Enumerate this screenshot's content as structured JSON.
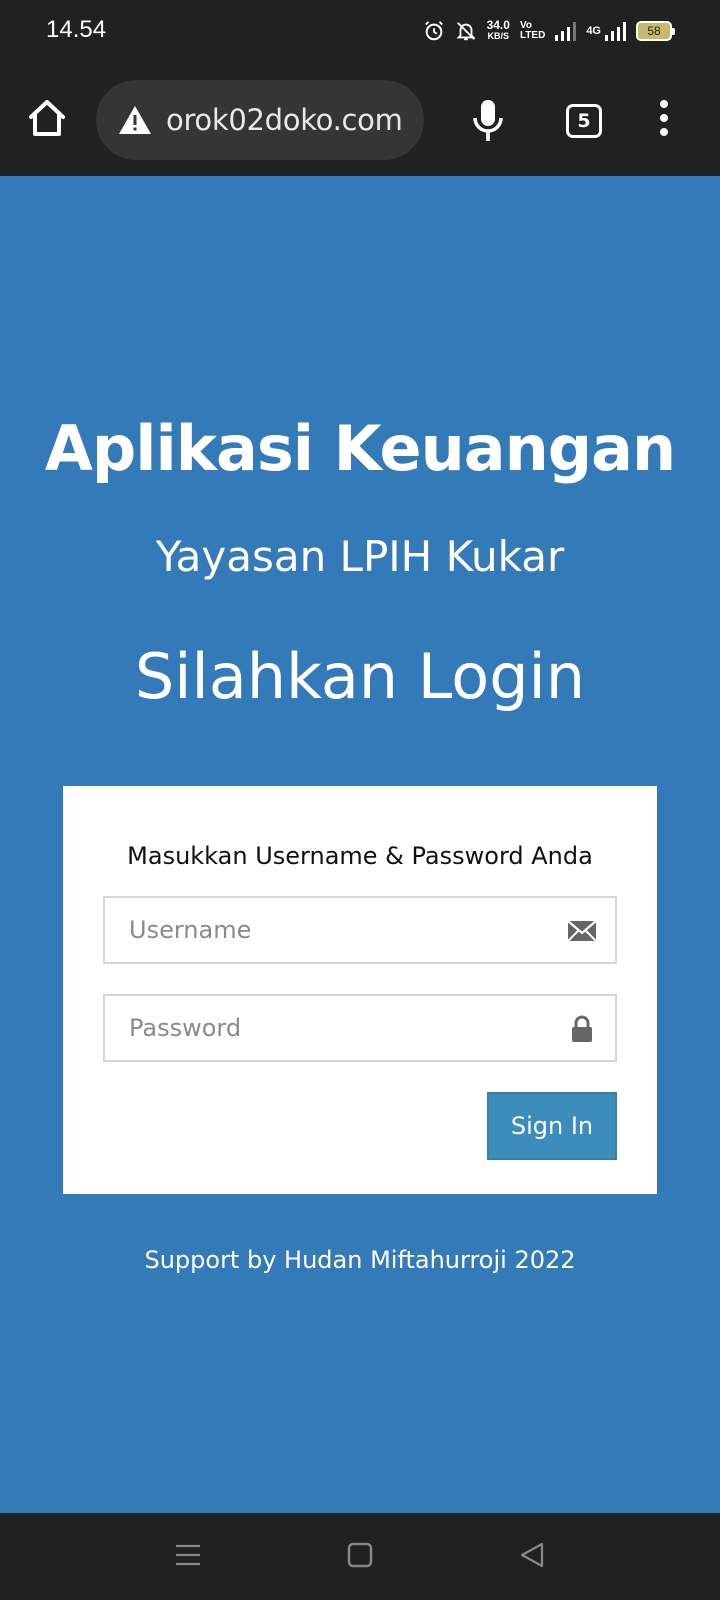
{
  "status_bar": {
    "time": "14.54",
    "net_speed": "34.0",
    "net_speed_unit": "KB/S",
    "volte_top": "Vo",
    "volte_bottom": "LTED",
    "network_type": "4G",
    "battery": "58"
  },
  "browser": {
    "url": "orok02doko.com",
    "tab_count": "5"
  },
  "page": {
    "title": "Aplikasi Keuangan",
    "subtitle": "Yayasan LPIH Kukar",
    "login_heading": "Silahkan Login",
    "form": {
      "instruction": "Masukkan Username & Password Anda",
      "username_placeholder": "Username",
      "password_placeholder": "Password",
      "submit_label": "Sign In"
    },
    "footer": "Support by Hudan Miftahurroji 2022"
  },
  "colors": {
    "page_background": "#3479b8",
    "button": "#3c8dbc",
    "system_bar": "#212121"
  },
  "icons": [
    "home-icon",
    "warning-icon",
    "mic-icon",
    "tabs-icon",
    "more-vert-icon",
    "envelope-icon",
    "lock-icon",
    "alarm-icon",
    "bell-off-icon",
    "recents-icon",
    "home-square-icon",
    "back-icon"
  ]
}
